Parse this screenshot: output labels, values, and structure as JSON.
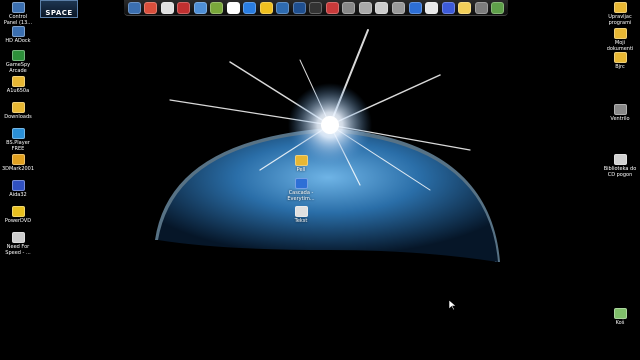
{
  "top_badge": {
    "label": "SPACE"
  },
  "dock": {
    "icons": [
      {
        "name": "control-panel-icon",
        "color": "#3b6fb0"
      },
      {
        "name": "chrome-icon",
        "color": "#d94f3c"
      },
      {
        "name": "explorer-icon",
        "color": "#e0e0e0"
      },
      {
        "name": "cursor-tool-icon",
        "color": "#c03030"
      },
      {
        "name": "network-icon",
        "color": "#4f8fd6"
      },
      {
        "name": "messenger-icon",
        "color": "#7aa83b"
      },
      {
        "name": "media-center-icon",
        "color": "#ffffff"
      },
      {
        "name": "play-icon",
        "color": "#2a7de1"
      },
      {
        "name": "winamp-icon",
        "color": "#f0c020"
      },
      {
        "name": "power-icon",
        "color": "#2e6bb0"
      },
      {
        "name": "monitor-icon",
        "color": "#1f4f8f"
      },
      {
        "name": "phone-icon",
        "color": "#333333"
      },
      {
        "name": "recorder-icon",
        "color": "#c83a3a"
      },
      {
        "name": "eye-icon",
        "color": "#888888"
      },
      {
        "name": "gear-icon",
        "color": "#aaaaaa"
      },
      {
        "name": "disc-icon",
        "color": "#cccccc"
      },
      {
        "name": "camera-icon",
        "color": "#999999"
      },
      {
        "name": "edit-icon",
        "color": "#2d6fd6"
      },
      {
        "name": "fan-icon",
        "color": "#e8e8e8"
      },
      {
        "name": "lightning-icon",
        "color": "#3d5bd9"
      },
      {
        "name": "folder-icon",
        "color": "#f3d05a"
      },
      {
        "name": "photo-icon",
        "color": "#7d7d7d"
      },
      {
        "name": "recycle-icon",
        "color": "#5fa04a"
      }
    ]
  },
  "desktop_left": [
    {
      "name": "control-panel",
      "label": "Control\nPanel (13...",
      "color": "#3b6fb0"
    },
    {
      "name": "hd-adock",
      "label": "HD ADock",
      "color": "#3b6fb0"
    },
    {
      "name": "gamespy-arcade",
      "label": "GameSpy\nArcade",
      "color": "#2d8f3a"
    },
    {
      "name": "a1u650a",
      "label": "A1u650a",
      "color": "#e7b734"
    },
    {
      "name": "downloads",
      "label": "Downloads",
      "color": "#e7b734"
    },
    {
      "name": "bsplayer-free",
      "label": "BS.Player\nFREE",
      "color": "#2a8fd6"
    },
    {
      "name": "3dmark2001",
      "label": "3DMark2001",
      "color": "#e0a020"
    },
    {
      "name": "aida32",
      "label": "Aida32",
      "color": "#3050c0"
    },
    {
      "name": "powerdvd",
      "label": "PowerDVD",
      "color": "#e8c020"
    },
    {
      "name": "need-for-speed",
      "label": "Need For\nSpeed - ...",
      "color": "#cccccc"
    }
  ],
  "desktop_right": [
    {
      "name": "upravljac-programi",
      "label": "Upravljac\nprogrami",
      "color": "#e7b734"
    },
    {
      "name": "moji-dokumenti",
      "label": "Moji\ndokumenti",
      "color": "#e7b734"
    },
    {
      "name": "bjrc",
      "label": "Bjrc",
      "color": "#e7b734"
    },
    {
      "name": "ventrilo",
      "label": "Ventrilo",
      "color": "#888888"
    },
    {
      "name": "biblioteka-cd-pogon",
      "label": "Biblioteka do\nCD pogon",
      "color": "#d0d0d0"
    },
    {
      "name": "koš",
      "label": "Koš",
      "color": "#7fbf6a"
    }
  ],
  "desktop_center": [
    {
      "name": "folder-center",
      "label": "Pell",
      "color": "#e7b734"
    },
    {
      "name": "cascada",
      "label": "Cascada -\nEverytim...",
      "color": "#2d6fd6"
    },
    {
      "name": "tekst",
      "label": "Tekst",
      "color": "#e0e0e0"
    }
  ]
}
